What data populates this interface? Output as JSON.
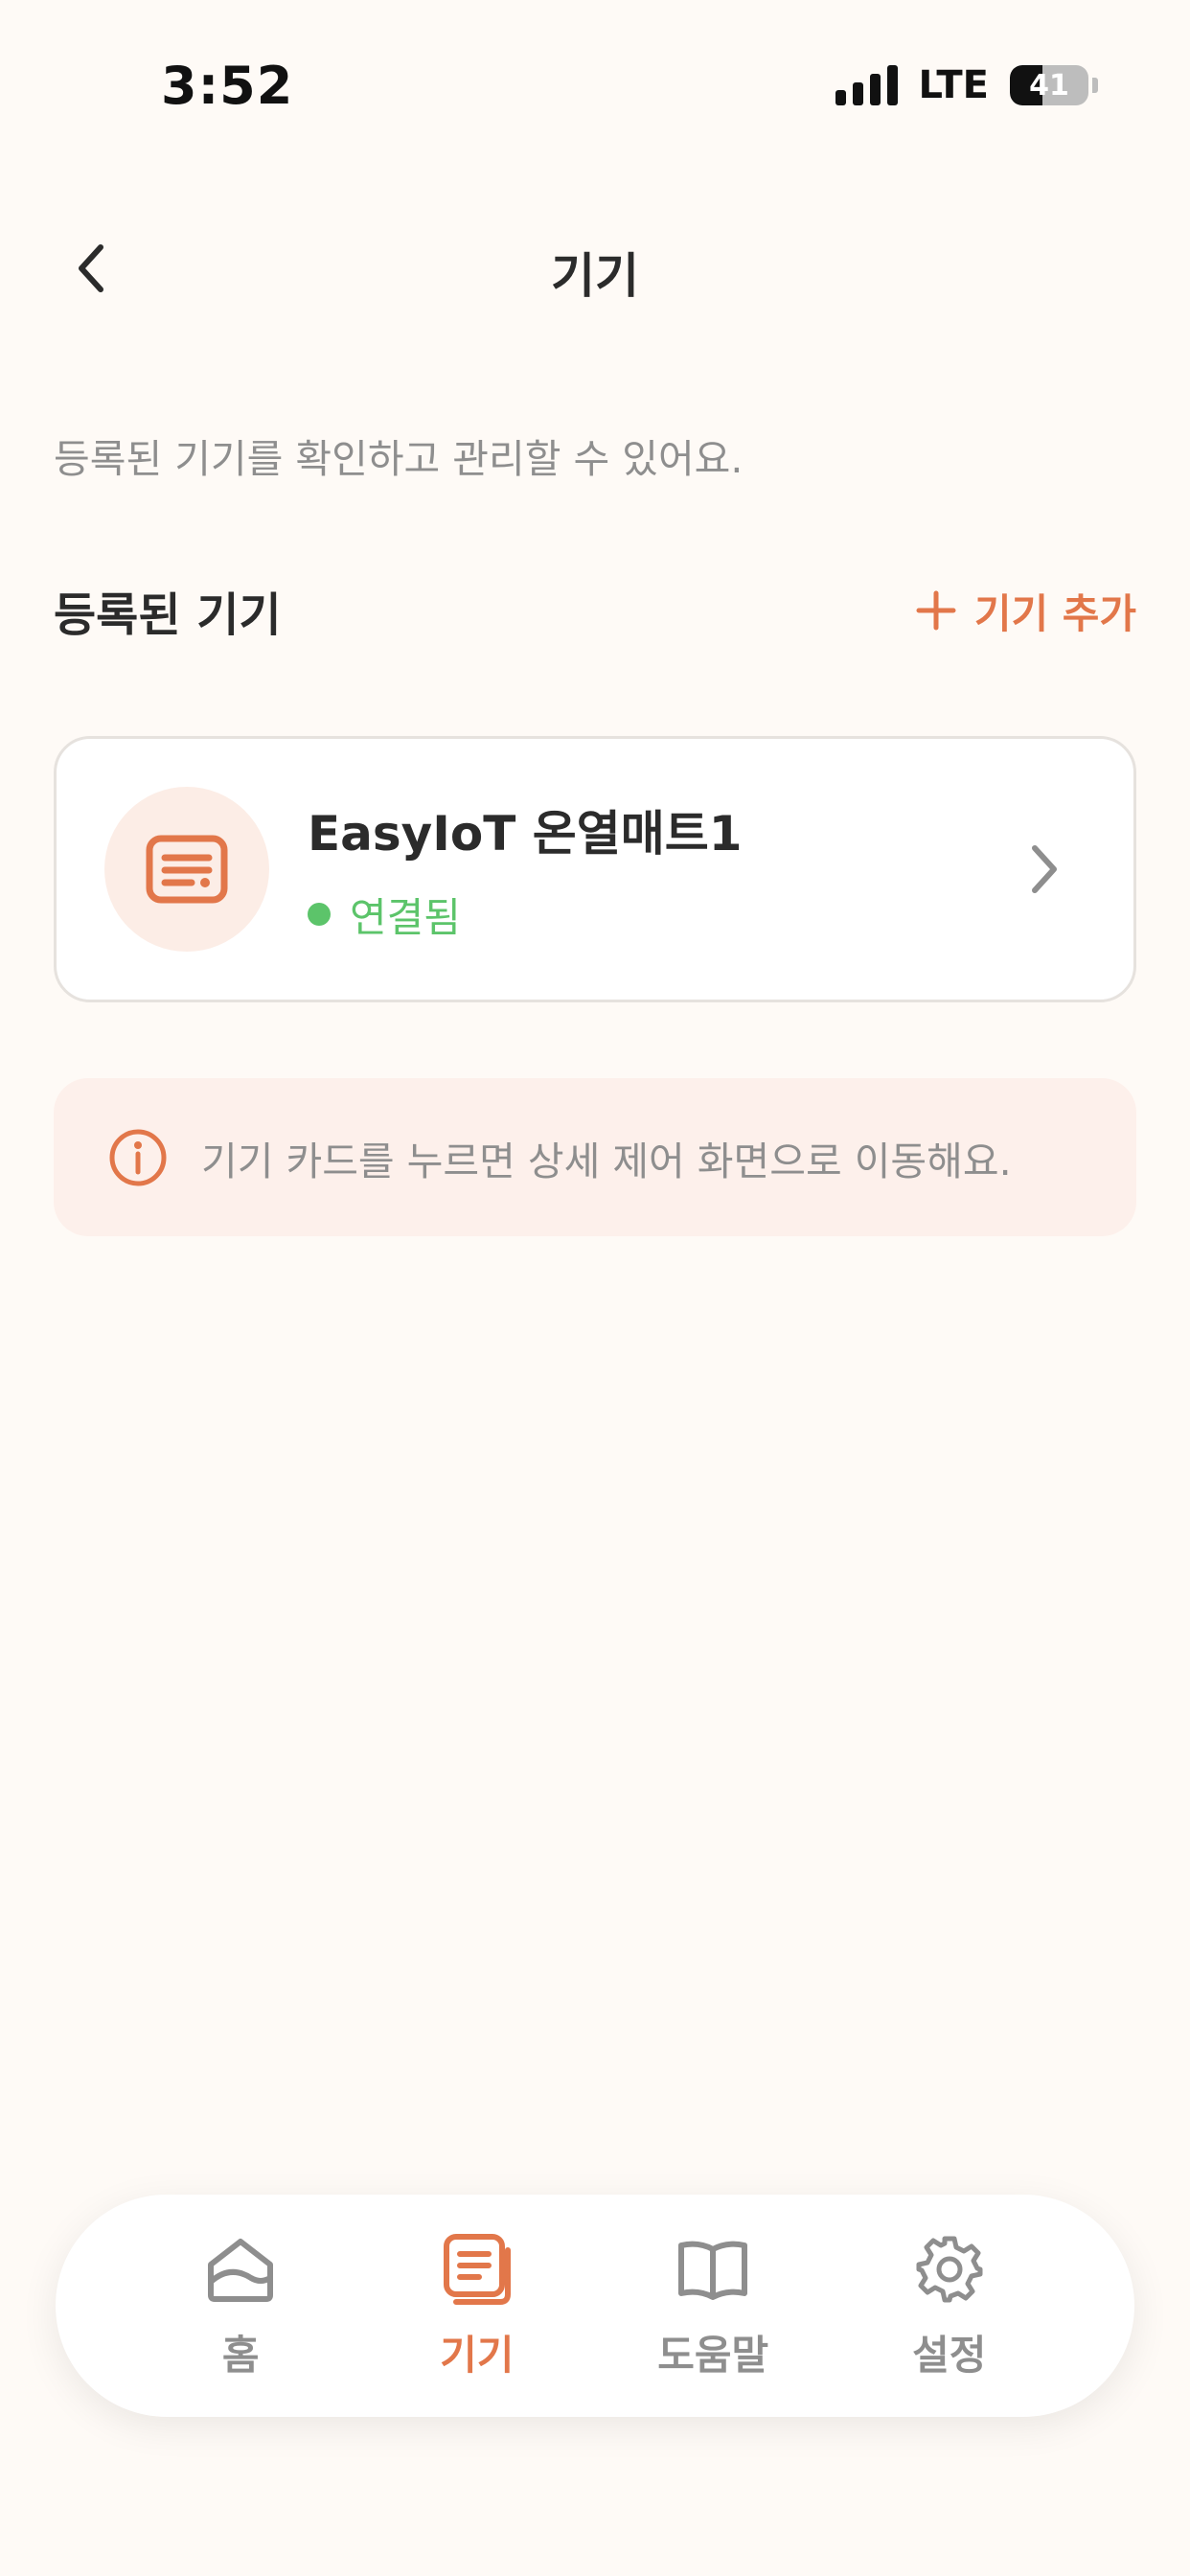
{
  "status_bar": {
    "time": "3:52",
    "network": "LTE",
    "battery": "41",
    "battery_level": 0.41
  },
  "nav": {
    "title": "기기"
  },
  "description": "등록된 기기를 확인하고 관리할 수 있어요.",
  "section": {
    "title": "등록된 기기",
    "add_label": "기기 추가"
  },
  "devices": [
    {
      "name": "EasyIoT 온열매트1",
      "status": "연결됨",
      "status_color": "#5CC46A",
      "icon": "heating-mat-icon"
    }
  ],
  "info": {
    "text": "기기 카드를 누르면 상세 제어 화면으로 이동해요."
  },
  "tabs": [
    {
      "label": "홈",
      "icon": "home-icon",
      "active": false
    },
    {
      "label": "기기",
      "icon": "device-icon",
      "active": true
    },
    {
      "label": "도움말",
      "icon": "book-icon",
      "active": false
    },
    {
      "label": "설정",
      "icon": "gear-icon",
      "active": false
    }
  ],
  "colors": {
    "accent": "#E2774A",
    "background": "#FEFAF6",
    "muted": "#8E8E8E",
    "connected": "#5CC46A"
  }
}
